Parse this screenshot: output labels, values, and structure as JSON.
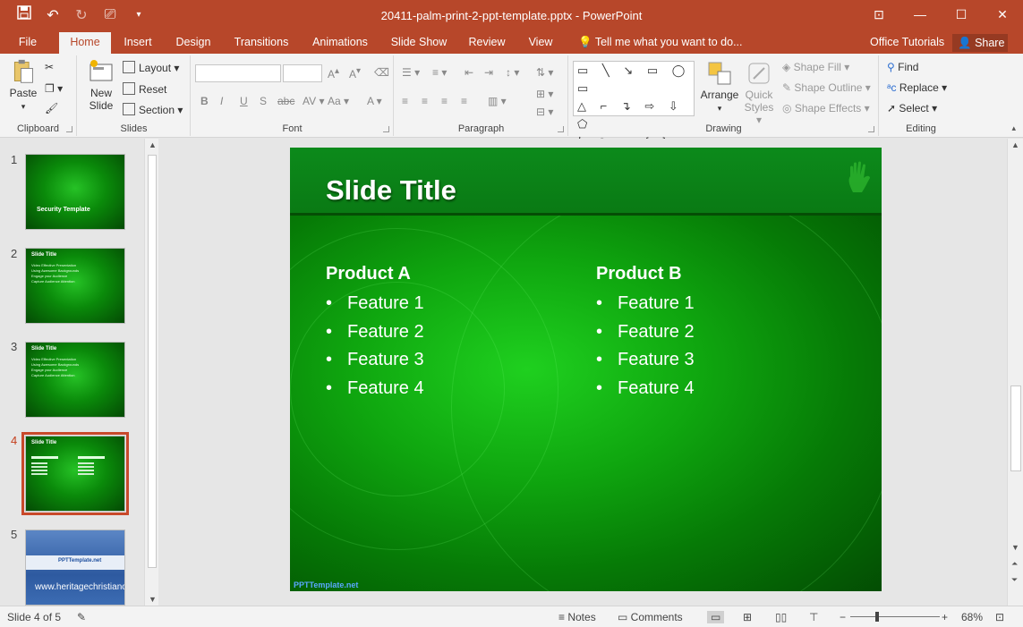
{
  "window": {
    "title": "20411-palm-print-2-ppt-template.pptx - PowerPoint",
    "accent_color": "#b7472a"
  },
  "qat": [
    "save-icon",
    "undo-icon",
    "redo-icon",
    "present-icon",
    "customize-icon"
  ],
  "tabs": [
    {
      "label": "File"
    },
    {
      "label": "Home"
    },
    {
      "label": "Insert"
    },
    {
      "label": "Design"
    },
    {
      "label": "Transitions"
    },
    {
      "label": "Animations"
    },
    {
      "label": "Slide Show"
    },
    {
      "label": "Review"
    },
    {
      "label": "View"
    }
  ],
  "tell_me": "Tell me what you want to do...",
  "office_tutorials": "Office Tutorials",
  "share": "Share",
  "ribbon": {
    "clipboard": {
      "paste": "Paste",
      "label": "Clipboard"
    },
    "slides": {
      "new_slide_1": "New",
      "new_slide_2": "Slide",
      "layout": "Layout",
      "reset": "Reset",
      "section": "Section",
      "label": "Slides"
    },
    "font": {
      "label": "Font"
    },
    "paragraph": {
      "label": "Paragraph"
    },
    "drawing": {
      "arrange": "Arrange",
      "quick_styles_1": "Quick",
      "quick_styles_2": "Styles",
      "shape_fill": "Shape Fill",
      "shape_outline": "Shape Outline",
      "shape_effects": "Shape Effects",
      "label": "Drawing"
    },
    "editing": {
      "find": "Find",
      "replace": "Replace",
      "select": "Select",
      "label": "Editing"
    }
  },
  "thumbnails": [
    {
      "num": "1",
      "title": "Security Template"
    },
    {
      "num": "2",
      "title": "Slide Title",
      "lines": [
        "Video Effective Presentation",
        "Using Awesome Backgrounds",
        "Engage your Audience",
        "Capture Audience Attention"
      ]
    },
    {
      "num": "3",
      "title": "Slide Title",
      "lines": [
        "Video Effective Presentation",
        "Using Awesome Backgrounds",
        "Engage your Audience",
        "Capture Audience Attention"
      ]
    },
    {
      "num": "4",
      "title": "Slide Title"
    },
    {
      "num": "5",
      "title": "PPTTemplate.net",
      "watermark": "www.heritagechristiancollege.com"
    }
  ],
  "slide": {
    "title": "Slide Title",
    "col_a": {
      "heading": "Product A",
      "features": [
        "Feature 1",
        "Feature 2",
        "Feature 3",
        "Feature 4"
      ]
    },
    "col_b": {
      "heading": "Product B",
      "features": [
        "Feature 1",
        "Feature 2",
        "Feature 3",
        "Feature 4"
      ]
    },
    "footer_link": "PPTTemplate.net"
  },
  "status": {
    "slide_of": "Slide 4 of 5",
    "notes": "Notes",
    "comments": "Comments",
    "zoom": "68%"
  }
}
